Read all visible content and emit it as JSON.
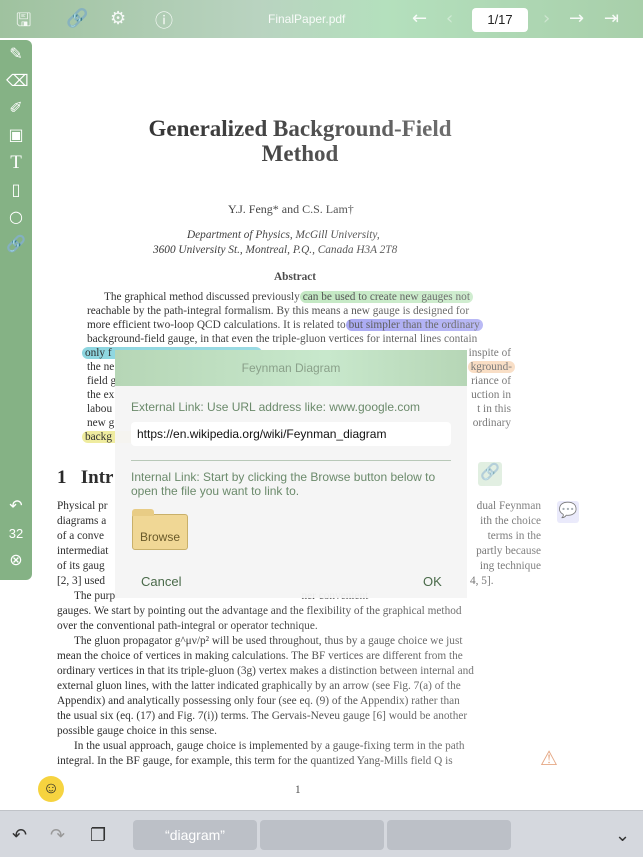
{
  "topbar": {
    "title": "FinalPaper.pdf",
    "page": "1/17",
    "icons": [
      "save-icon",
      "link-icon",
      "settings-icon",
      "info-icon",
      "back-arrow-icon",
      "prev-page-icon",
      "next-page-icon",
      "forward-arrow-icon",
      "exit-icon"
    ]
  },
  "paper": {
    "title1": "Generalized Background-Field",
    "title2": "Method",
    "authors": "Y.J. Feng* and C.S. Lam†",
    "affil1": "Department of Physics, McGill University,",
    "affil2": "3600 University St., Montreal, P.Q., Canada H3A 2T8",
    "abstract_heading": "Abstract",
    "abs": [
      {
        "l": "The graphical method discussed previously",
        "h": "can be used to create new gauges not"
      },
      {
        "l": "reachable by the path-integral formalism. By this means a new gauge is designed for"
      },
      {
        "l": "more efficient two-loop QCD calculations. It is related to",
        "h": "but simpler than the ordinary"
      },
      {
        "l": "background-field gauge, in that even the triple-gluon vertices for internal lines contain"
      }
    ],
    "abs_frag_left": [
      "only f",
      "the ne",
      "field g",
      "the ex",
      "labou",
      "new g",
      "backg"
    ],
    "abs_frag_right": [
      "inspite of",
      "kground-",
      "riance of",
      "uction in",
      "t in this",
      "ordinary"
    ],
    "section": "1   Intr",
    "sec_frag_left": [
      "Physical pr",
      "diagrams a",
      "of a conve",
      "intermediat",
      "of its gaug",
      "[2, 3] used"
    ],
    "sec_frag_right": [
      "dual Feynman",
      "ith the choice",
      "terms in the",
      "partly because",
      "ing technique",
      "4, 5]."
    ],
    "body": [
      "The purp                                                                  ner convenient",
      "gauges. We start by pointing out the advantage and the flexibility of the graphical method",
      "over the conventional path-integral or operator technique.",
      "The gluon propagator g^μν/p² will be used throughout, thus by a gauge choice we just",
      "mean the choice of vertices in making calculations. The BF vertices are different from the",
      "ordinary vertices in that its triple-gluon (3g) vertex makes a distinction between internal and",
      "external gluon lines, with the latter indicated graphically by an arrow (see Fig. 7(a) of the",
      "Appendix) and analytically possessing only four (see eq. (9) of the Appendix) rather than",
      "the usual six (eq. (17) and Fig. 7(i)) terms. The Gervais-Neveu gauge [6] would be another",
      "possible gauge choice in this sense.",
      "In the usual approach, gauge choice is implemented by a gauge-fixing term in the path",
      "integral. In the BF gauge, for example, this term for the quantized Yang-Mills field Q is"
    ],
    "page_number": "1"
  },
  "tools": {
    "undo_count": "32"
  },
  "dialog": {
    "title": "Feynman Diagram",
    "external_label": "External Link: Use URL address like: www.google.com",
    "url_value": "https://en.wikipedia.org/wiki/Feynman_diagram",
    "internal_label": "Internal Link: Start by clicking the Browse button below to open the file you want to link to.",
    "browse": "Browse",
    "cancel": "Cancel",
    "ok": "OK"
  },
  "keyboard": {
    "suggestions": [
      "“diagram”",
      "",
      ""
    ]
  },
  "colors": {
    "green_highlight": "#b5e3b5",
    "blue_highlight": "#8f8fef",
    "cyan_highlight": "#88d4de",
    "orange_highlight": "#f5c9a0",
    "yellow_highlight": "#eeeb9a"
  }
}
